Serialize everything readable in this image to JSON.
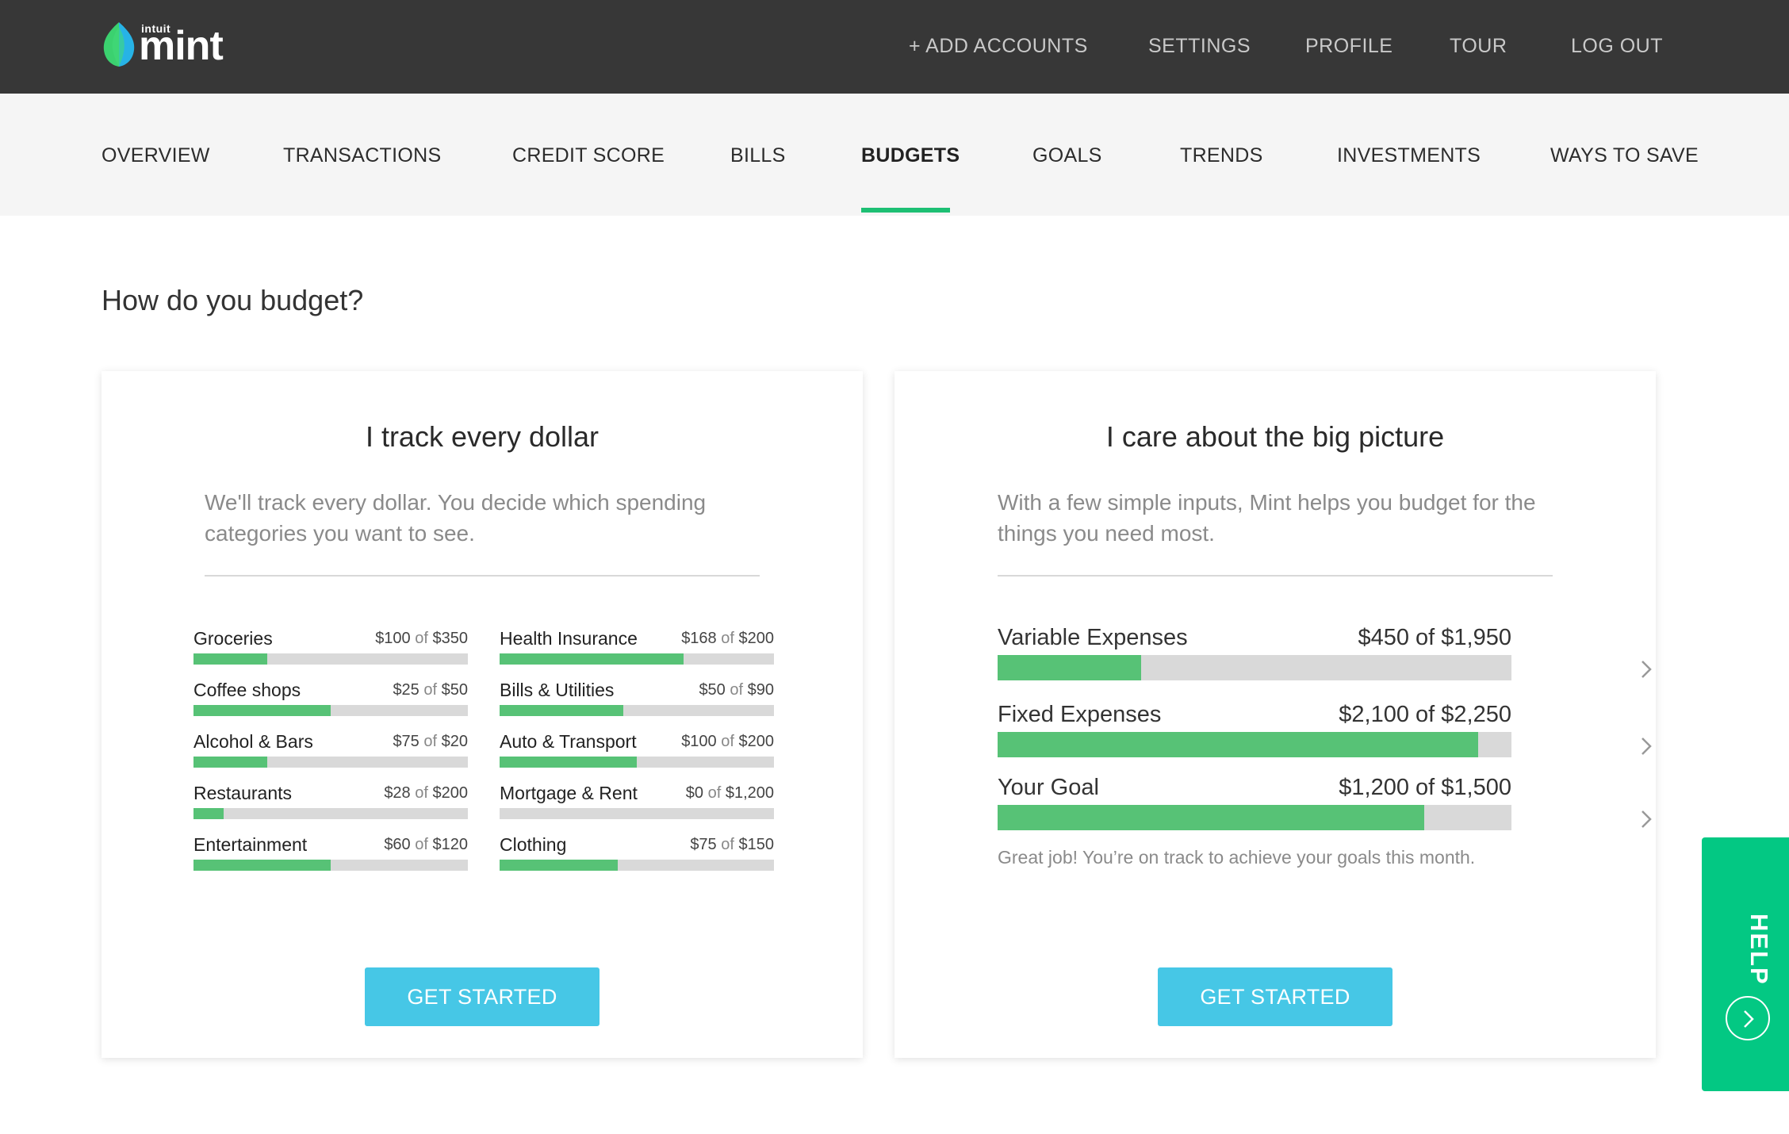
{
  "brand": {
    "small": "intuit",
    "name": "mint",
    "leaf_colors": [
      "#3bd16f",
      "#27b3e6"
    ]
  },
  "top_nav": [
    "+ ADD ACCOUNTS",
    "SETTINGS",
    "PROFILE",
    "TOUR",
    "LOG OUT"
  ],
  "tabs": [
    "OVERVIEW",
    "TRANSACTIONS",
    "CREDIT SCORE",
    "BILLS",
    "BUDGETS",
    "GOALS",
    "TRENDS",
    "INVESTMENTS",
    "WAYS TO SAVE"
  ],
  "active_tab": "BUDGETS",
  "heading": "How do you budget?",
  "left_card": {
    "title": "I track every dollar",
    "description": "We'll track every dollar. You decide which spending categories you want to see.",
    "categories": [
      {
        "name": "Groceries",
        "spent": "$100",
        "of": "of",
        "budget": "$350",
        "progress": 0.27
      },
      {
        "name": "Health Insurance",
        "spent": "$168",
        "of": "of",
        "budget": "$200",
        "progress": 0.67
      },
      {
        "name": "Coffee shops",
        "spent": "$25",
        "of": "of",
        "budget": "$50",
        "progress": 0.5
      },
      {
        "name": "Bills & Utilities",
        "spent": "$50",
        "of": "of",
        "budget": "$90",
        "progress": 0.45
      },
      {
        "name": "Alcohol & Bars",
        "spent": "$75",
        "of": "of",
        "budget": "$20",
        "progress": 0.27
      },
      {
        "name": "Auto & Transport",
        "spent": "$100",
        "of": "of",
        "budget": "$200",
        "progress": 0.5
      },
      {
        "name": "Restaurants",
        "spent": "$28",
        "of": "of",
        "budget": "$200",
        "progress": 0.11
      },
      {
        "name": "Mortgage & Rent",
        "spent": "$0",
        "of": "of",
        "budget": "$1,200",
        "progress": 0
      },
      {
        "name": "Entertainment",
        "spent": "$60",
        "of": "of",
        "budget": "$120",
        "progress": 0.5
      },
      {
        "name": "Clothing",
        "spent": "$75",
        "of": "of",
        "budget": "$150",
        "progress": 0.43
      }
    ],
    "button": "GET STARTED"
  },
  "right_card": {
    "title": "I care about the big picture",
    "description": "With a few simple inputs, Mint helps you budget for the things you need most.",
    "rows": [
      {
        "name": "Variable Expenses",
        "amount": "$450 of $1,950",
        "progress": 0.28
      },
      {
        "name": "Fixed Expenses",
        "amount": "$2,100 of $2,250",
        "progress": 0.935
      },
      {
        "name": "Your Goal",
        "amount": "$1,200 of $1,500",
        "progress": 0.83
      }
    ],
    "note": "Great job! You’re on track to achieve your goals this month.",
    "button": "GET STARTED"
  },
  "help": {
    "label": "HELP"
  },
  "colors": {
    "topbar": "#373737",
    "accent_green": "#1dbf73",
    "bar_green": "#57c276",
    "button_blue": "#46c7e6",
    "help_green": "#03c883"
  }
}
